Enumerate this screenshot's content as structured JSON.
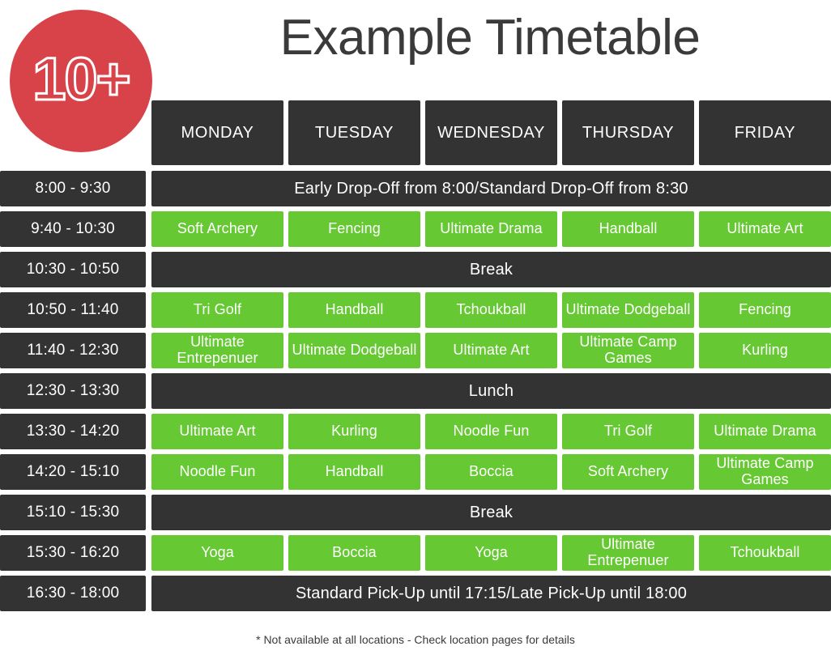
{
  "badge": {
    "label": "10+",
    "color": "#d84249"
  },
  "title": "Example Timetable",
  "colors": {
    "green": "#66c933",
    "dark": "#333333",
    "red": "#d84249"
  },
  "header": {
    "days": [
      "MONDAY",
      "TUESDAY",
      "WEDNESDAY",
      "THURSDAY",
      "FRIDAY"
    ]
  },
  "rows": [
    {
      "time": "8:00 - 9:30",
      "type": "banner",
      "text": "Early Drop-Off from 8:00/Standard Drop-Off from 8:30"
    },
    {
      "time": "9:40 - 10:30",
      "type": "activity",
      "cells": [
        "Soft Archery",
        "Fencing",
        "Ultimate Drama",
        "Handball",
        "Ultimate Art"
      ]
    },
    {
      "time": "10:30 - 10:50",
      "type": "banner",
      "text": "Break"
    },
    {
      "time": "10:50 - 11:40",
      "type": "activity",
      "cells": [
        "Tri Golf",
        "Handball",
        "Tchoukball",
        "Ultimate Dodgeball",
        "Fencing"
      ]
    },
    {
      "time": "11:40 - 12:30",
      "type": "activity",
      "cells": [
        "Ultimate Entrepenuer",
        "Ultimate Dodgeball",
        "Ultimate Art",
        "Ultimate Camp Games",
        "Kurling"
      ]
    },
    {
      "time": "12:30 - 13:30",
      "type": "banner",
      "text": "Lunch"
    },
    {
      "time": "13:30 - 14:20",
      "type": "activity",
      "cells": [
        "Ultimate Art",
        "Kurling",
        "Noodle Fun",
        "Tri Golf",
        "Ultimate Drama"
      ]
    },
    {
      "time": "14:20 - 15:10",
      "type": "activity",
      "cells": [
        "Noodle Fun",
        "Handball",
        "Boccia",
        "Soft Archery",
        "Ultimate Camp Games"
      ]
    },
    {
      "time": "15:10 - 15:30",
      "type": "banner",
      "text": "Break"
    },
    {
      "time": "15:30 - 16:20",
      "type": "activity",
      "cells": [
        "Yoga",
        "Boccia",
        "Yoga",
        "Ultimate Entrepenuer",
        "Tchoukball"
      ]
    },
    {
      "time": "16:30 - 18:00",
      "type": "banner",
      "text": "Standard Pick-Up until 17:15/Late Pick-Up until 18:00"
    }
  ],
  "footnote": "* Not available at all locations - Check location pages for details"
}
